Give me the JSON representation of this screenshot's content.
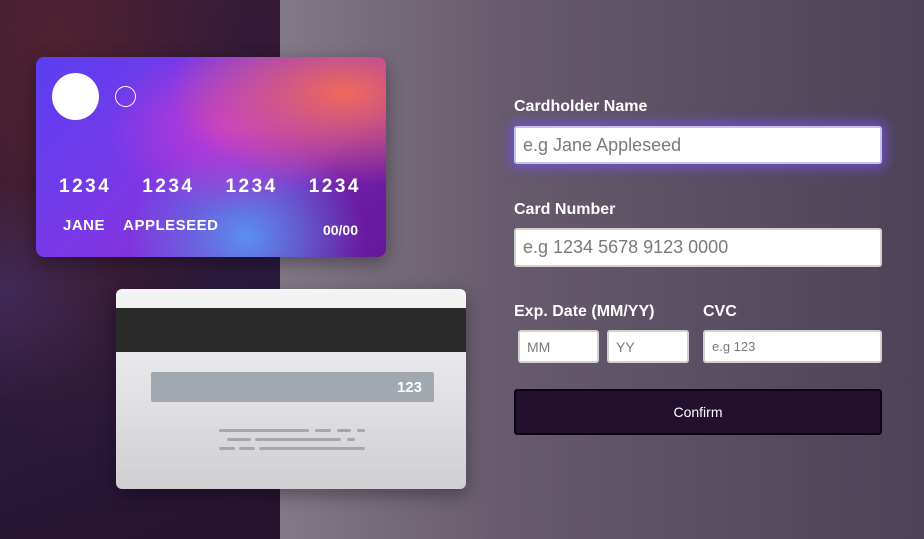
{
  "card_front": {
    "numbers": [
      "1234",
      "1234",
      "1234",
      "1234"
    ],
    "name": "JANE APPLESEED",
    "expiry": "00/00"
  },
  "card_back": {
    "cvc": "123"
  },
  "form": {
    "cardholder_label": "Cardholder Name",
    "cardholder_placeholder": "e.g Jane Appleseed",
    "number_label": "Card Number",
    "number_placeholder": "e.g 1234 5678 9123 0000",
    "exp_label": "Exp. Date (MM/YY)",
    "mm_placeholder": "MM",
    "yy_placeholder": "YY",
    "cvc_label": "CVC",
    "cvc_placeholder": "e.g 123",
    "confirm_label": "Confirm"
  },
  "colors": {
    "accent_glow": "#7850e6",
    "button_bg": "#22102e"
  }
}
